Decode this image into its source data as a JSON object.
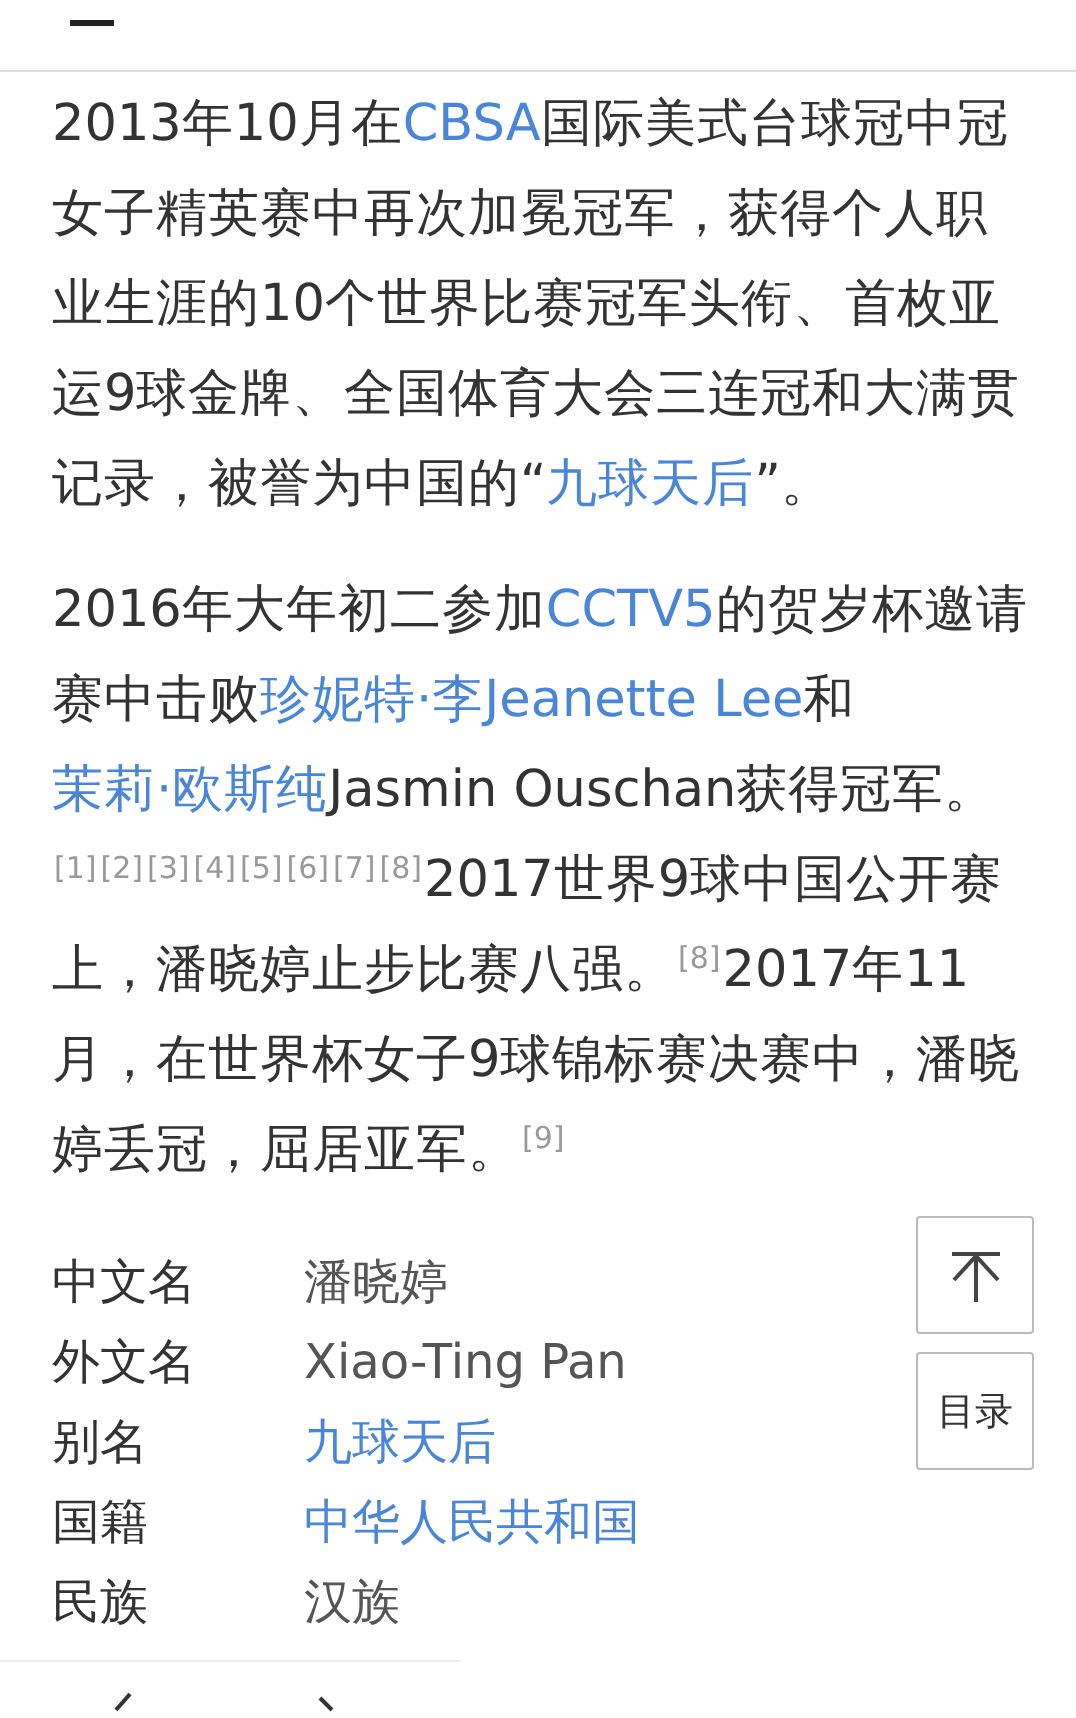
{
  "paragraphs": [
    {
      "segments": [
        {
          "kind": "text",
          "text": "2013年10月在"
        },
        {
          "kind": "link",
          "text": "CBSA"
        },
        {
          "kind": "text",
          "text": "国际美式台球冠中冠女子精英赛中再次加冕冠军，获得个人职业生涯的10个世界比赛冠军头衔、首枚亚运9球金牌、全国体育大会三连冠和大满贯记录，被誉为中国的“"
        },
        {
          "kind": "link",
          "text": "九球天后"
        },
        {
          "kind": "text",
          "text": "”。"
        }
      ]
    },
    {
      "segments": [
        {
          "kind": "text",
          "text": "2016年大年初二参加"
        },
        {
          "kind": "link",
          "text": "CCTV5"
        },
        {
          "kind": "text",
          "text": "的贺岁杯邀请赛中击败"
        },
        {
          "kind": "link",
          "text": "珍妮特·李Jeanette Lee"
        },
        {
          "kind": "text",
          "text": "和"
        },
        {
          "kind": "link",
          "text": "茉莉·欧斯纯"
        },
        {
          "kind": "text",
          "text": "Jasmin Ouschan获得冠军。"
        },
        {
          "kind": "ref",
          "text": "[1]"
        },
        {
          "kind": "ref",
          "text": "[2]"
        },
        {
          "kind": "ref",
          "text": "[3]"
        },
        {
          "kind": "ref",
          "text": "[4]"
        },
        {
          "kind": "ref",
          "text": "[5]"
        },
        {
          "kind": "ref",
          "text": "[6]"
        },
        {
          "kind": "ref",
          "text": "[7]"
        },
        {
          "kind": "ref",
          "text": "[8]"
        },
        {
          "kind": "text",
          "text": "2017世界9球中国公开赛上，潘晓婷止步比赛八强。"
        },
        {
          "kind": "ref",
          "text": "[8]"
        },
        {
          "kind": "text",
          "text": "2017年11月，在世界杯女子9球锦标赛决赛中，潘晓婷丢冠，屈居亚军。"
        },
        {
          "kind": "ref",
          "text": "[9]"
        }
      ]
    }
  ],
  "float_buttons": [
    {
      "kind": "top"
    },
    {
      "kind": "toc",
      "label": "目录"
    }
  ],
  "infobox": [
    {
      "label": "中文名",
      "value": "潘晓婷",
      "link": false
    },
    {
      "label": "外文名",
      "value": "Xiao-Ting Pan",
      "link": false
    },
    {
      "label": "别名",
      "value": "九球天后",
      "link": true
    },
    {
      "label": "国籍",
      "value": "中华人民共和国",
      "link": true
    },
    {
      "label": "民族",
      "value": "汉族",
      "link": false
    }
  ]
}
